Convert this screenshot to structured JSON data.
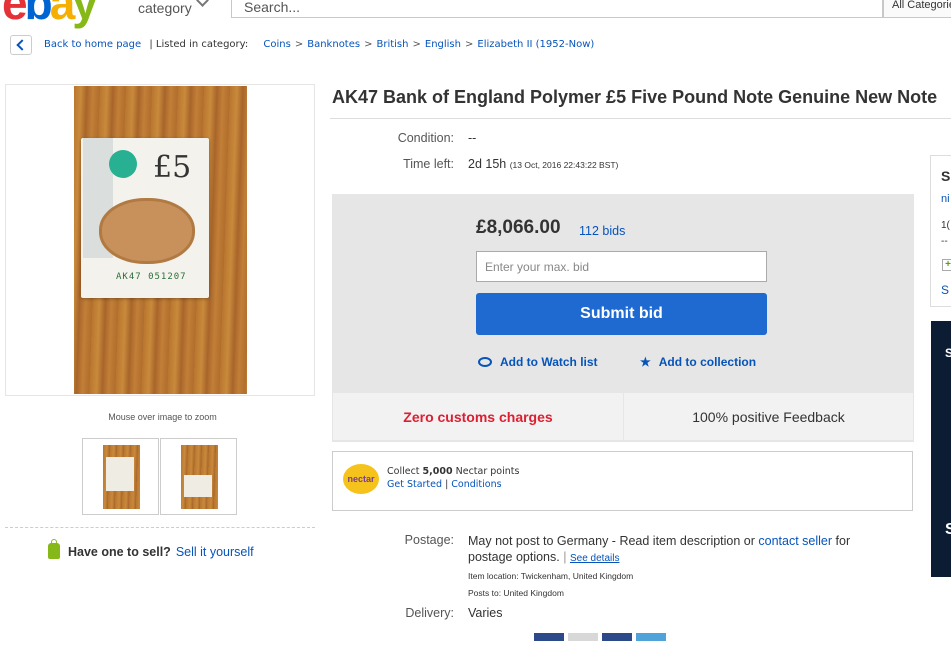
{
  "header": {
    "logo": {
      "e": "e",
      "b": "b",
      "a": "a",
      "y": "y"
    },
    "category_label": "category",
    "search_placeholder": "Search...",
    "all_categories": "All Categories"
  },
  "breadcrumb": {
    "back": "Back to home page",
    "listed_in": "| Listed in category:",
    "items": [
      "Coins",
      "Banknotes",
      "British",
      "English",
      "Elizabeth II (1952-Now)"
    ]
  },
  "gallery": {
    "note_value": "£5",
    "note_serial": "AK47 051207",
    "zoom_hint": "Mouse over image to zoom"
  },
  "sell": {
    "question": "Have one to sell?",
    "link": "Sell it yourself"
  },
  "item": {
    "title": "AK47 Bank of England Polymer £5 Five Pound Note Genuine New Note",
    "condition_label": "Condition:",
    "condition_value": "--",
    "time_label": "Time left:",
    "time_value": "2d 15h",
    "time_detail": "(13 Oct, 2016  22:43:22 BST)"
  },
  "bid": {
    "price": "£8,066.00",
    "bids": "112 bids",
    "input_placeholder": "Enter your max. bid",
    "submit": "Submit bid",
    "watch": "Add to Watch list",
    "collection": "Add to collection",
    "customs": "Zero customs charges",
    "feedback": "100% positive Feedback"
  },
  "nectar": {
    "logo": "nectar",
    "collect_pre": "Collect ",
    "points": "5,000",
    "collect_post": " Nectar points",
    "get_started": "Get Started",
    "sep": " | ",
    "conditions": "Conditions"
  },
  "postage": {
    "label": "Postage:",
    "text_pre": "May not post to Germany - Read item description or ",
    "contact": "contact seller",
    "text_post": " for postage options.",
    "see_details": "See details",
    "location": "Item location:  Twickenham, United Kingdom",
    "posts_to": "Posts to:  United Kingdom",
    "delivery_label": "Delivery:",
    "delivery_value": "Varies"
  },
  "seller_panel": {
    "heading": "S",
    "name": "ni",
    "line1": "1(",
    "line2": "--",
    "plus": "+",
    "link": "S"
  },
  "ad_panel": {
    "t1": "S",
    "t2": "S"
  }
}
